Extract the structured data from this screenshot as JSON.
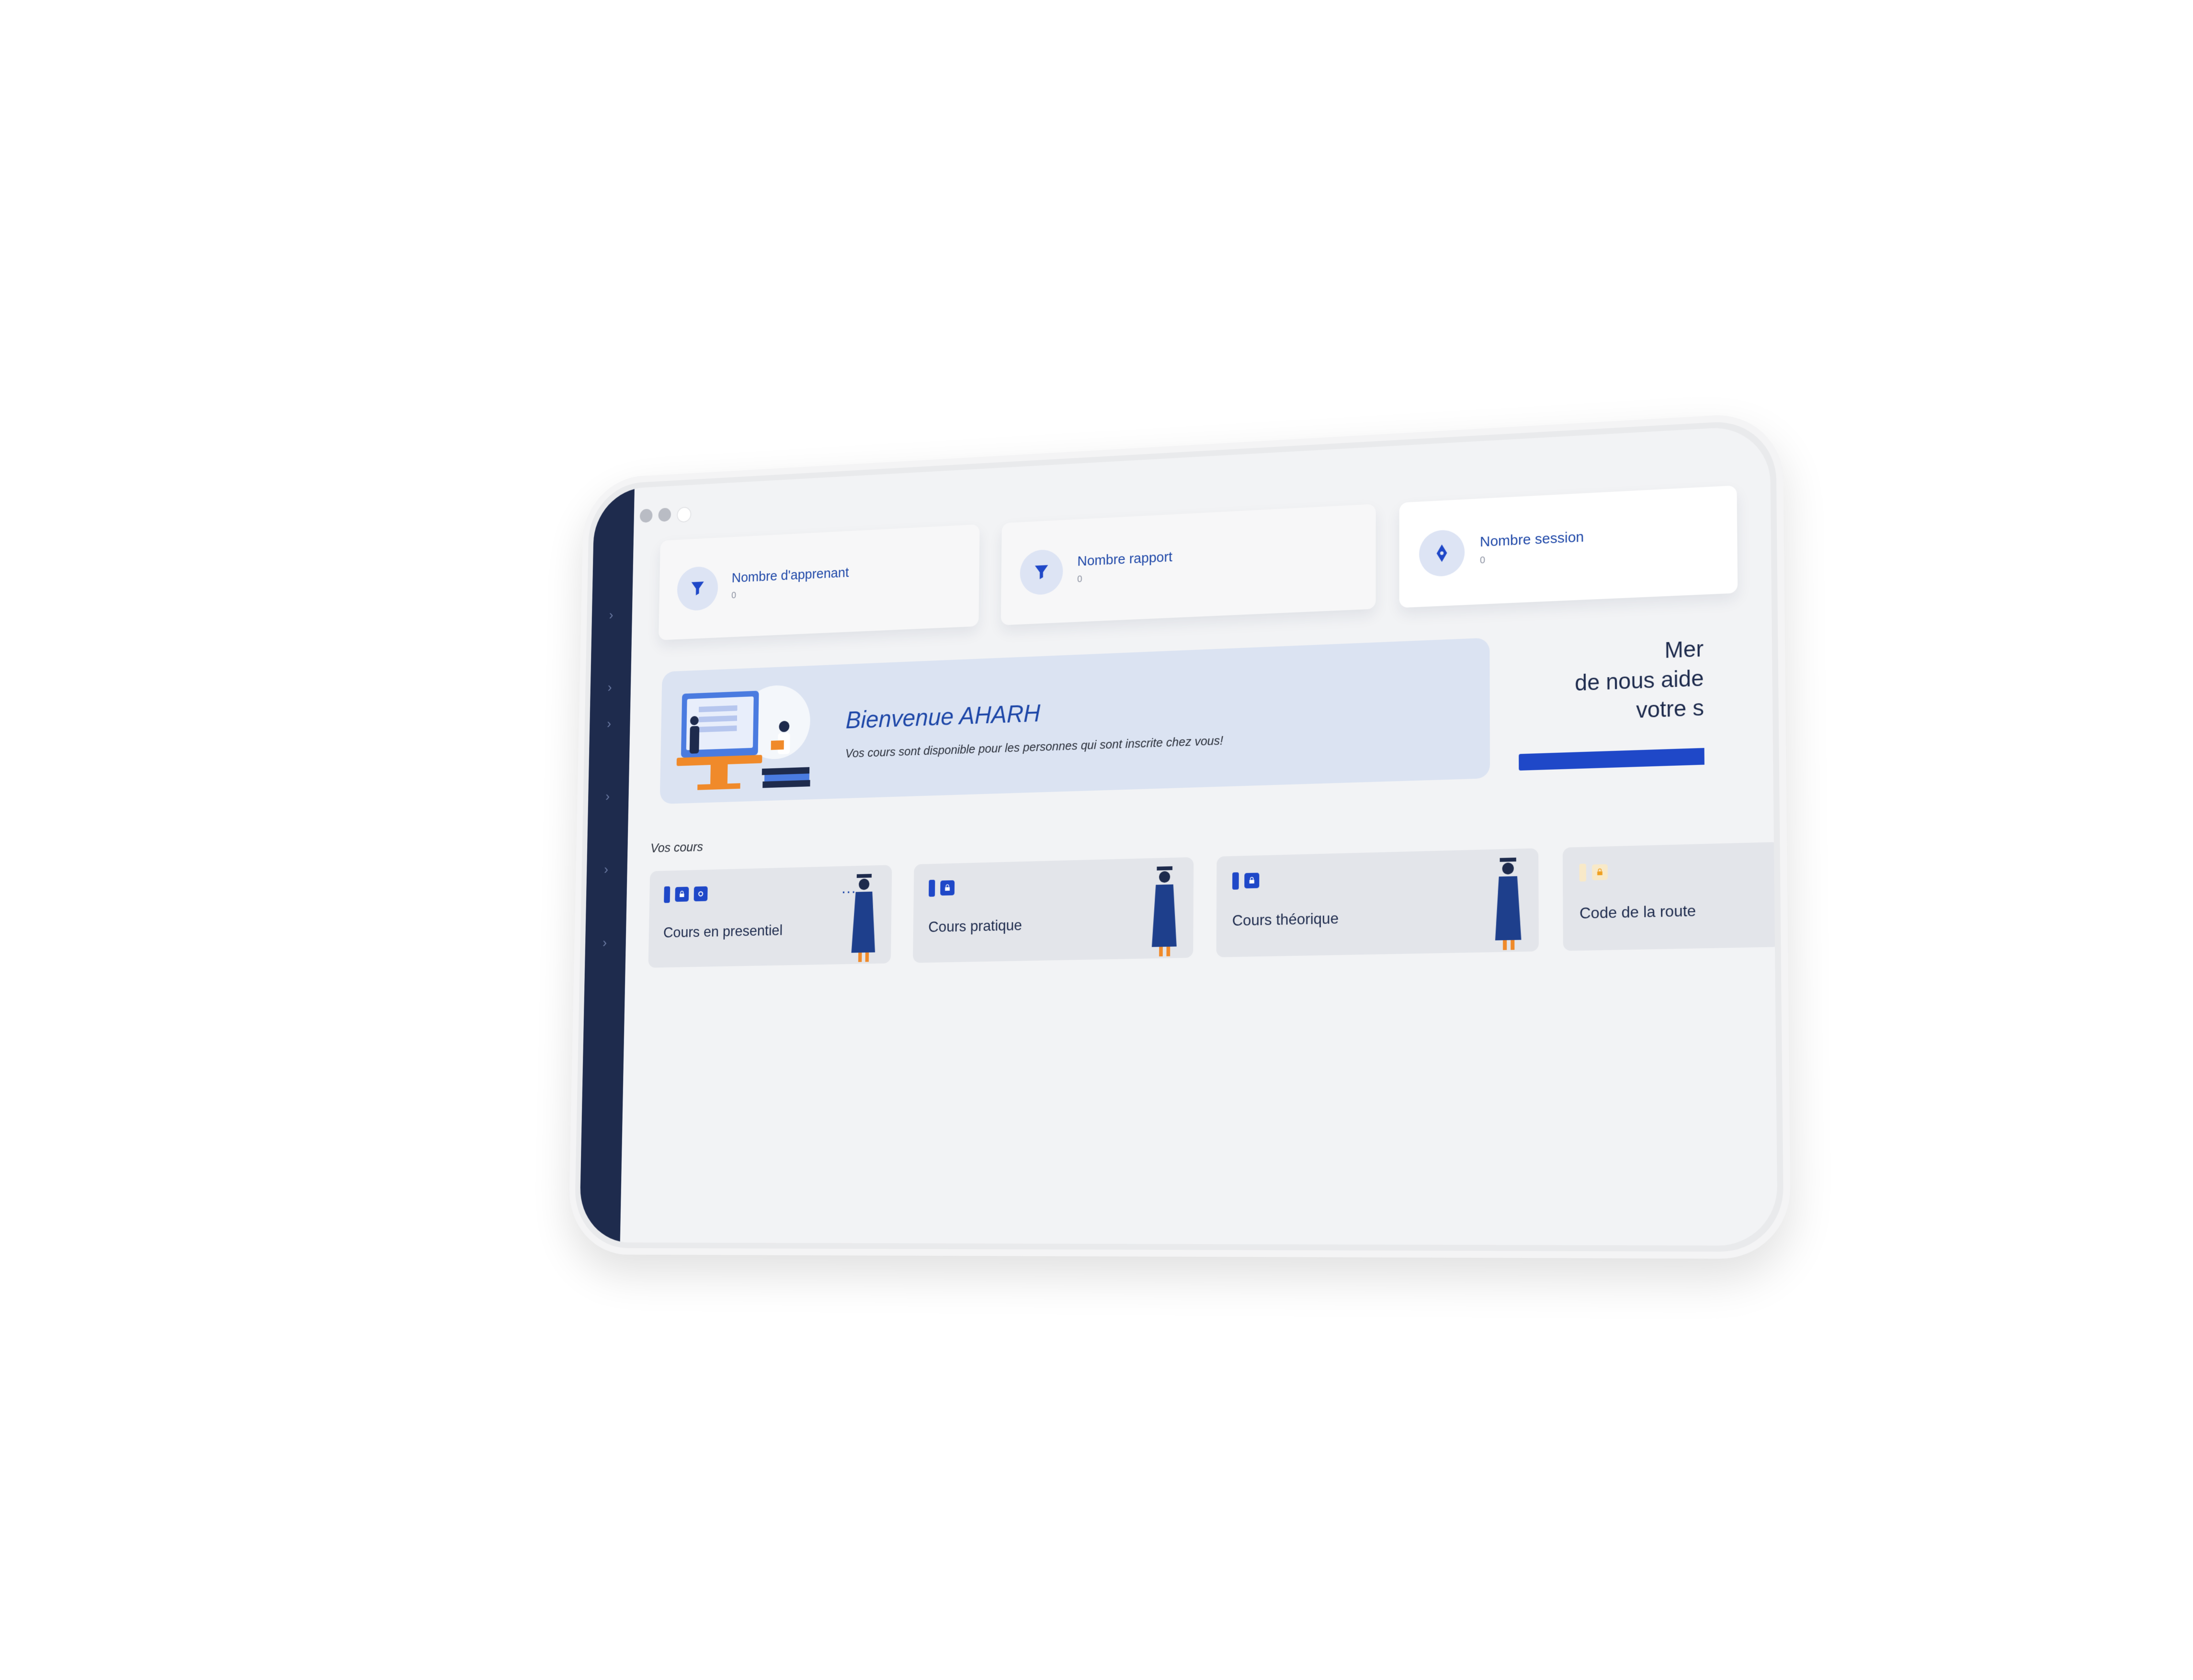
{
  "stats": [
    {
      "label": "Nombre d'apprenant",
      "value": "0",
      "icon": "filter-icon"
    },
    {
      "label": "Nombre rapport",
      "value": "0",
      "icon": "filter-icon"
    },
    {
      "label": "Nombre session",
      "value": "0",
      "icon": "pen-nib-icon"
    }
  ],
  "banner": {
    "title": "Bienvenue AHARH",
    "subtitle": "Vos cours sont disponible pour les personnes qui sont inscrite chez vous!"
  },
  "promo": {
    "line1": "Mer",
    "line2": "de nous aide",
    "line3": "votre s"
  },
  "courses_section": {
    "title": "Vos cours"
  },
  "courses": [
    {
      "name": "Cours en presentiel",
      "more": "..."
    },
    {
      "name": "Cours pratique"
    },
    {
      "name": "Cours théorique"
    },
    {
      "name": "Code de la route"
    }
  ],
  "colors": {
    "accent": "#1f48c8",
    "sidebar": "#1e2b4d",
    "banner_bg": "#dbe3f2",
    "card_bg": "#e3e5ea"
  }
}
